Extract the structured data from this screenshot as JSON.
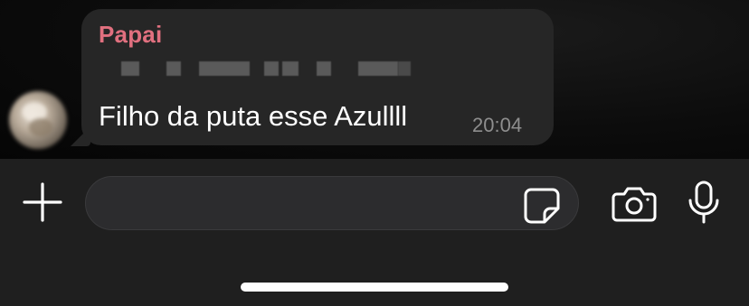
{
  "message": {
    "sender": "Papai",
    "text": "Filho da puta esse Azullll",
    "time": "20:04",
    "sender_color": "#e1707f"
  },
  "composer": {
    "input_value": "",
    "input_placeholder": ""
  },
  "icons": {
    "add": "plus-icon",
    "sticker": "sticker-icon",
    "camera": "camera-icon",
    "mic": "microphone-icon"
  }
}
